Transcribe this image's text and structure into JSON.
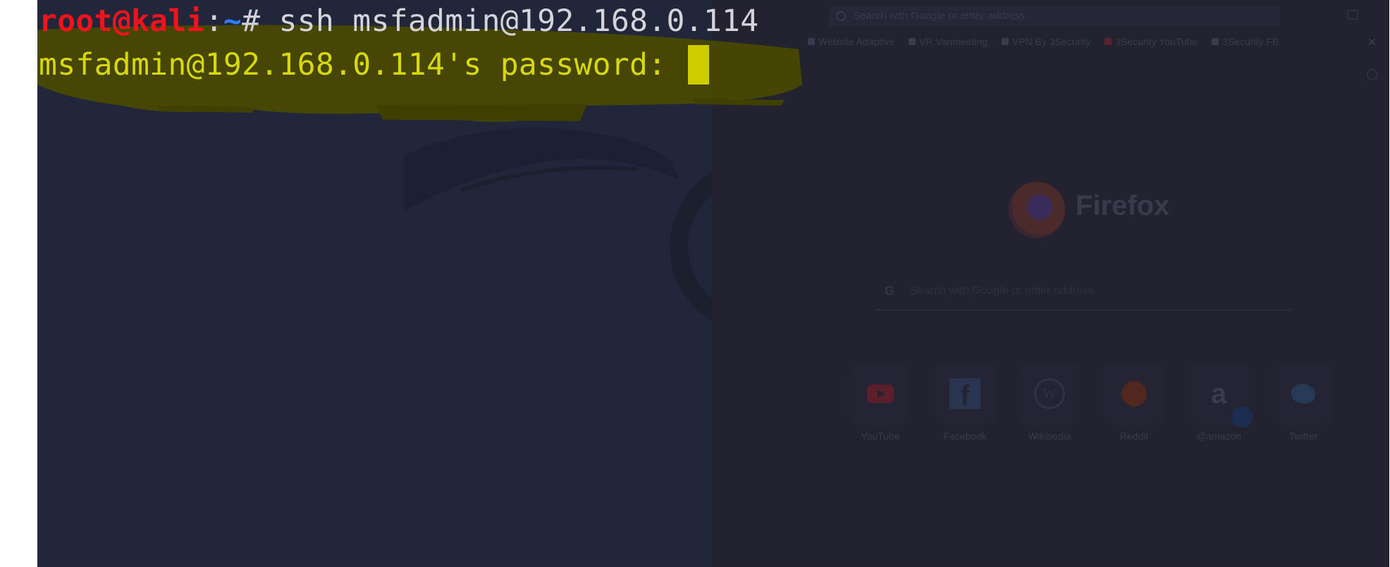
{
  "terminal": {
    "prompt_user_host": "root@kali",
    "prompt_colon": ":",
    "prompt_dir": "~",
    "prompt_symbol": "#",
    "command": " ssh msfadmin@192.168.0.114",
    "password_prompt": "msfadmin@192.168.0.114's password: "
  },
  "firefox": {
    "url_placeholder": "Search with Google or enter address",
    "bookmarks": [
      {
        "label": "Website Adaptive",
        "icon": "bookmark-icon"
      },
      {
        "label": "VR Vanmeeting",
        "icon": "bookmark-icon"
      },
      {
        "label": "VPN By 3Security",
        "icon": "bookmark-icon"
      },
      {
        "label": "3Security YouTube",
        "icon": "youtube-icon"
      },
      {
        "label": "3Security FB",
        "icon": "facebook-icon"
      }
    ],
    "wordmark": "Firefox",
    "search_placeholder": "Search with Google or enter address",
    "tiles": [
      {
        "label": "YouTube",
        "icon": "youtube-icon"
      },
      {
        "label": "Facebook",
        "icon": "facebook-icon"
      },
      {
        "label": "Wikipedia",
        "icon": "wikipedia-icon"
      },
      {
        "label": "Reddit",
        "icon": "reddit-icon"
      },
      {
        "label": "@amazon",
        "icon": "amazon-icon"
      },
      {
        "label": "Twitter",
        "icon": "twitter-icon"
      }
    ]
  },
  "colors": {
    "terminal_bg": "#22263a",
    "prompt_red": "#f0121c",
    "prompt_blue": "#2f7cf6",
    "command_text": "#d4d4da",
    "password_yellow": "#d8d80c",
    "highlight_yellow": "#4d4d00"
  }
}
